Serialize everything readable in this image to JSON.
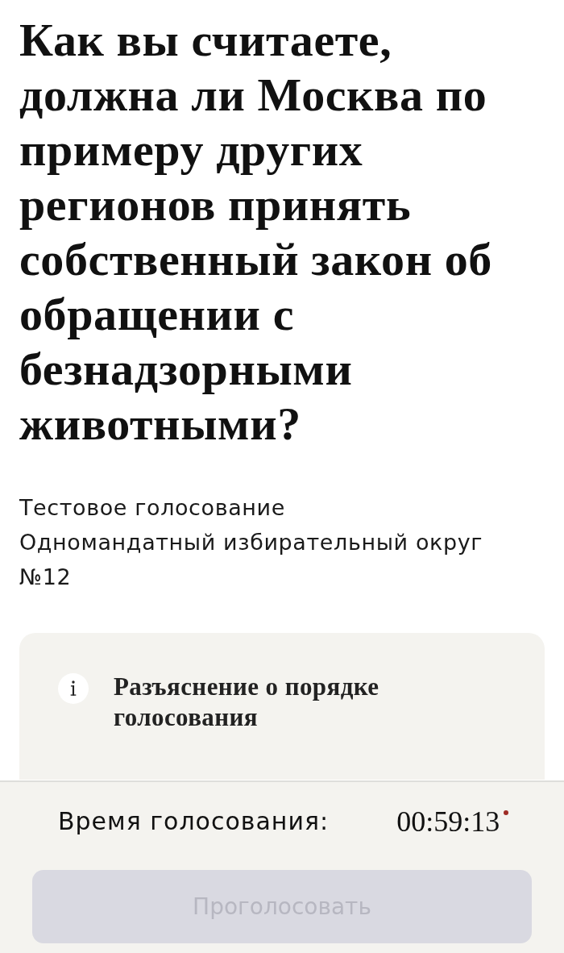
{
  "question": {
    "title": "Как вы считаете, должна ли Москва по примеру других регионов принять собственный закон об обращении с безнадзорными животными?",
    "subtitle_lines": [
      "Тестовое голосование",
      "Одномандатный избирательный округ №12"
    ]
  },
  "info_card": {
    "text": "Разъяснение о порядке голосования"
  },
  "footer": {
    "timer_label": "Время голосования:",
    "timer_value": "00:59:13",
    "vote_button": {
      "label": "Проголосовать",
      "disabled": true
    }
  }
}
